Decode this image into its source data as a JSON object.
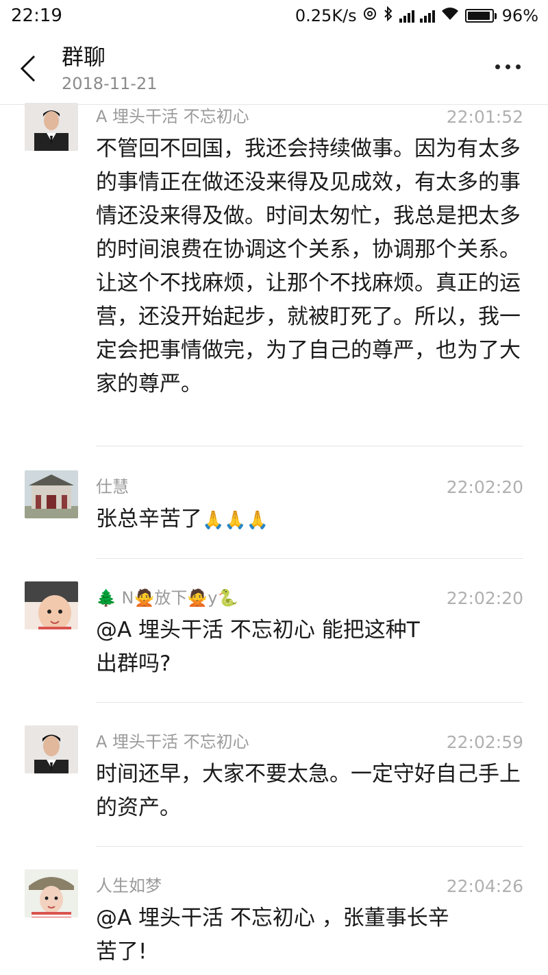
{
  "status": {
    "time": "22:19",
    "speed": "0.25K/s",
    "battery": "96%"
  },
  "header": {
    "title": "群聊",
    "subtitle": "2018-11-21"
  },
  "messages": [
    {
      "name": "A 埋头干活 不忘初心",
      "time": "22:01:52",
      "text": "不管回不回国，我还会持续做事。因为有太多的事情正在做还没来得及见成效，有太多的事情还没来得及做。时间太匆忙，我总是把太多的时间浪费在协调这个关系，协调那个关系。让这个不找麻烦，让那个不找麻烦。真正的运营，还没开始起步，就被盯死了。所以，我一定会把事情做完，为了自己的尊严，也为了大家的尊严。"
    },
    {
      "name": "仕慧",
      "time": "22:02:20",
      "text": "张总辛苦了",
      "emoji": "🙏🙏🙏"
    },
    {
      "name_parts": [
        "🌲 N",
        "🙅",
        "放下",
        "🙅",
        "y",
        "🐍"
      ],
      "time": "22:02:20",
      "text": "@A 埋头干活 不忘初心 能把这种T出群吗?"
    },
    {
      "name": "A 埋头干活 不忘初心",
      "time": "22:02:59",
      "text": "时间还早，大家不要太急。一定守好自己手上的资产。"
    },
    {
      "name": "人生如梦",
      "time": "22:04:26",
      "text": "@A 埋头干活 不忘初心 ，张董事长辛苦了!"
    }
  ]
}
